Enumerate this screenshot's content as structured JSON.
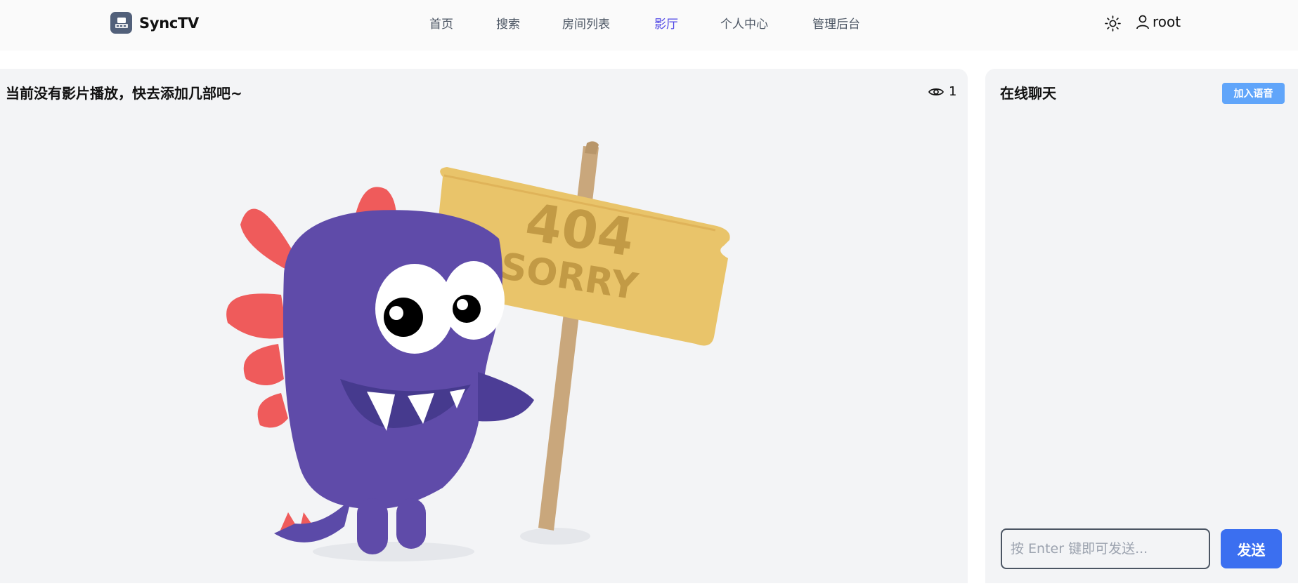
{
  "brand": {
    "name": "SyncTV",
    "logo_icon": "tv-logo-icon"
  },
  "nav": {
    "items": [
      {
        "label": "首页",
        "active": false
      },
      {
        "label": "搜索",
        "active": false
      },
      {
        "label": "房间列表",
        "active": false
      },
      {
        "label": "影厅",
        "active": true
      },
      {
        "label": "个人中心",
        "active": false
      },
      {
        "label": "管理后台",
        "active": false
      }
    ],
    "theme_icon": "sun-icon",
    "user": {
      "icon": "user-icon",
      "name": "root"
    }
  },
  "player": {
    "title": "当前没有影片播放，快去添加几部吧~",
    "viewer_icon": "eye-icon",
    "viewer_count": "1",
    "placeholder_sign": {
      "code": "404",
      "text": "SORRY"
    }
  },
  "chat": {
    "title": "在线聊天",
    "voice_button": "加入语音",
    "input": {
      "value": "",
      "placeholder": "按 Enter 键即可发送..."
    },
    "send_button": "发送"
  },
  "colors": {
    "accent": "#4f46e5",
    "voice_button": "#60a5fa",
    "send_button": "#3b6ff0",
    "panel_bg": "#f3f4f6"
  }
}
